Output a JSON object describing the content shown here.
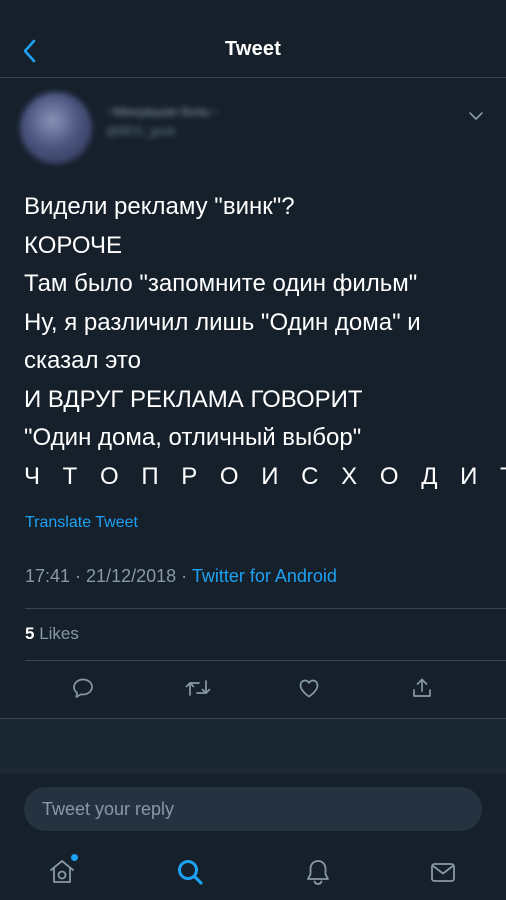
{
  "header": {
    "title": "Tweet",
    "back_icon": "chevron-left-icon"
  },
  "tweet": {
    "user_name": "~Минувшая боль~",
    "user_handle": "@BEG_gavk",
    "lines": [
      "Видели рекламу \"винк\"?",
      "КОРОЧЕ",
      "Там было \"запомните один фильм\"",
      "Ну, я различил лишь \"Один дома\" и",
      "сказал это",
      "И ВДРУГ РЕКЛАМА ГОВОРИТ",
      "\"Один дома, отличный выбор\"",
      "Ч Т О П Р О И С Х О Д И Т"
    ],
    "translate_label": "Translate Tweet",
    "timestamp": "17:41 · 21/12/2018 · ",
    "source": "Twitter for Android",
    "likes_count": "5",
    "likes_label": " Likes"
  },
  "reply": {
    "placeholder": "Tweet your reply"
  },
  "colors": {
    "background": "#15202b",
    "accent": "#1da1f2",
    "secondary_text": "#8899a6",
    "divider": "#38444d"
  },
  "icons": {
    "menu": "chevron-down-icon",
    "actions": [
      "reply-icon",
      "retweet-icon",
      "like-icon",
      "share-icon"
    ],
    "tabs": [
      "home-icon",
      "search-icon",
      "notifications-icon",
      "messages-icon"
    ]
  }
}
